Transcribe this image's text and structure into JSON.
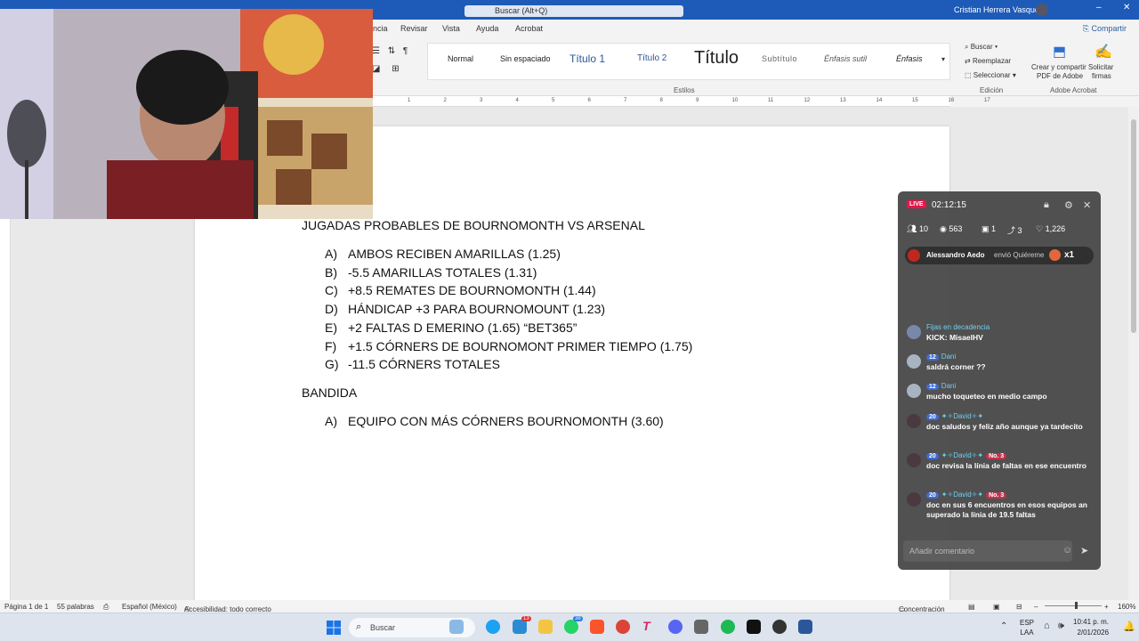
{
  "titlebar": {
    "search_placeholder": "Buscar (Alt+Q)",
    "user_name": "Cristian Herrera Vasquez",
    "minimize": "–",
    "close": "✕"
  },
  "ribbon": {
    "tabs": [
      "ncia",
      "Revisar",
      "Vista",
      "Ayuda",
      "Acrobat"
    ],
    "share_label": "Compartir",
    "styles": [
      "Normal",
      "Sin espaciado",
      "Título 1",
      "Título 2",
      "Título",
      "Subtítulo",
      "Énfasis sutil",
      "Énfasis"
    ],
    "styles_group_label": "Estilos",
    "editing": {
      "find": "Buscar",
      "replace": "Reemplazar",
      "select": "Seleccionar",
      "group_label": "Edición"
    },
    "adobe": {
      "create_share": "Crear y compartir",
      "pdf": "PDF de Adobe",
      "request": "Solicitar",
      "signatures": "firmas",
      "group_label": "Adobe Acrobat"
    }
  },
  "ruler_numbers": [
    "1",
    "2",
    "3",
    "4",
    "5",
    "6",
    "7",
    "8",
    "9",
    "10",
    "11",
    "12",
    "13",
    "14",
    "15",
    "16",
    "17"
  ],
  "document": {
    "heading1": "JUGADAS PROBABLES DE BOURNOMONTH VS ARSENAL",
    "list1": [
      {
        "letter": "A)",
        "text": "AMBOS RECIBEN AMARILLAS (1.25)"
      },
      {
        "letter": "B)",
        "text": "-5.5 AMARILLAS TOTALES (1.31)"
      },
      {
        "letter": "C)",
        "text": "+8.5 REMATES DE BOURNOMONTH (1.44)"
      },
      {
        "letter": "D)",
        "text": "HÁNDICAP +3 PARA BOURNOMOUNT (1.23)"
      },
      {
        "letter": "E)",
        "text": "+2 FALTAS D EMERINO (1.65) “BET365”"
      },
      {
        "letter": "F)",
        "text": "+1.5 CÓRNERS DE BOURNOMONT PRIMER TIEMPO (1.75)"
      },
      {
        "letter": "G)",
        "text": "-11.5 CÓRNERS TOTALES"
      }
    ],
    "heading2": "BANDIDA",
    "list2": [
      {
        "letter": "A)",
        "text": "EQUIPO CON MÁS CÓRNERS BOURNOMONTH (3.60)"
      }
    ]
  },
  "statusbar": {
    "page": "Página 1 de 1",
    "words": "55 palabras",
    "language": "Español (México)",
    "accessibility": "Accesibilidad: todo correcto",
    "focus": "Concentración",
    "zoom": "160%"
  },
  "taskbar": {
    "search_label": "Buscar",
    "lang_top": "ESP",
    "lang_bottom": "LAA",
    "time": "10:41 p. m.",
    "date": "2/01/2026",
    "badge_1": "13",
    "badge_2": "38"
  },
  "chat": {
    "live_label": "LIVE",
    "timer": "02:12:15",
    "stats": {
      "users": "10",
      "views": "563",
      "gifts": "1",
      "shares": "3",
      "likes": "1,226"
    },
    "gift_banner": {
      "sender": "Alessandro Aedo",
      "action": "envió Quiéreme",
      "count": "x1"
    },
    "messages": [
      {
        "name": "Fijas en decadencia",
        "level": "",
        "rank": "",
        "text": "KICK: MisaelHV"
      },
      {
        "name": "Dani",
        "level": "12",
        "rank": "",
        "text": "saldrá corner ??"
      },
      {
        "name": "Dani",
        "level": "12",
        "rank": "",
        "text": "mucho toqueteo en medio campo"
      },
      {
        "name": "✦✧David✧✦",
        "level": "20",
        "rank": "",
        "text": "doc saludos y feliz año aunque ya tardecito"
      },
      {
        "name": "✦✧David✧✦",
        "level": "20",
        "rank": "No. 3",
        "text": "doc revisa la línia de faltas en ese encuentro"
      },
      {
        "name": "✦✧David✧✦",
        "level": "20",
        "rank": "No. 3",
        "text": "doc en sus 6 encuentros en esos equipos an superado la línia de 19.5 faltas"
      }
    ],
    "comment_placeholder": "Añadir comentario"
  }
}
